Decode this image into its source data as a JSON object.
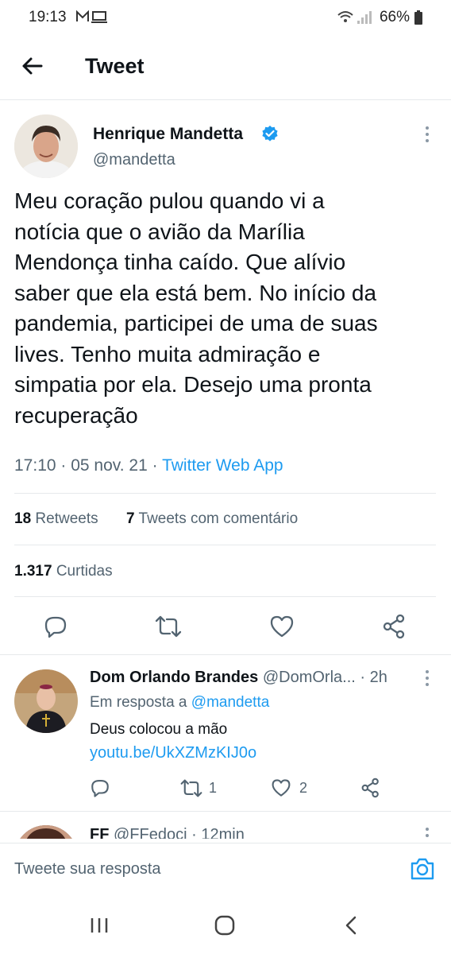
{
  "status_bar": {
    "time": "19:13",
    "notification_icons": [
      "gmail-icon",
      "screen-icon"
    ],
    "battery": "66%"
  },
  "header": {
    "title": "Tweet"
  },
  "tweet": {
    "author_name": "Henrique Mandetta",
    "handle": "@mandetta",
    "verified": true,
    "text_lines": [
      "Meu coração pulou quando vi a",
      "notícia que o avião da Marília",
      "Mendonça tinha caído. Que alívio",
      "saber que ela está bem. No início da",
      "pandemia, participei de uma de suas",
      "lives. Tenho muita admiração e",
      "simpatia por ela. Desejo uma pronta",
      "recuperação"
    ],
    "time": "17:10",
    "date": "05 nov. 21",
    "source": "Twitter Web App",
    "retweets_count": "18",
    "retweets_label": "Retweets",
    "quote_count": "7",
    "quote_label": "Tweets com comentário",
    "likes_count": "1.317",
    "likes_label": "Curtidas"
  },
  "replies": [
    {
      "name": "Dom Orlando Brandes",
      "handle": "@DomOrla...",
      "time": "2h",
      "reply_prefix": "Em resposta a",
      "reply_to": "@mandetta",
      "text": "Deus colocou a mão",
      "link": "youtu.be/UkXZMzKIJ0o",
      "retweets": "1",
      "likes": "2"
    },
    {
      "name": "FF",
      "handle": "@FFedoci",
      "time": "12min"
    }
  ],
  "reply_input": {
    "placeholder": "Tweete sua resposta"
  },
  "colors": {
    "accent": "#1d9bf0",
    "text": "#0f1419",
    "muted": "#536471"
  }
}
